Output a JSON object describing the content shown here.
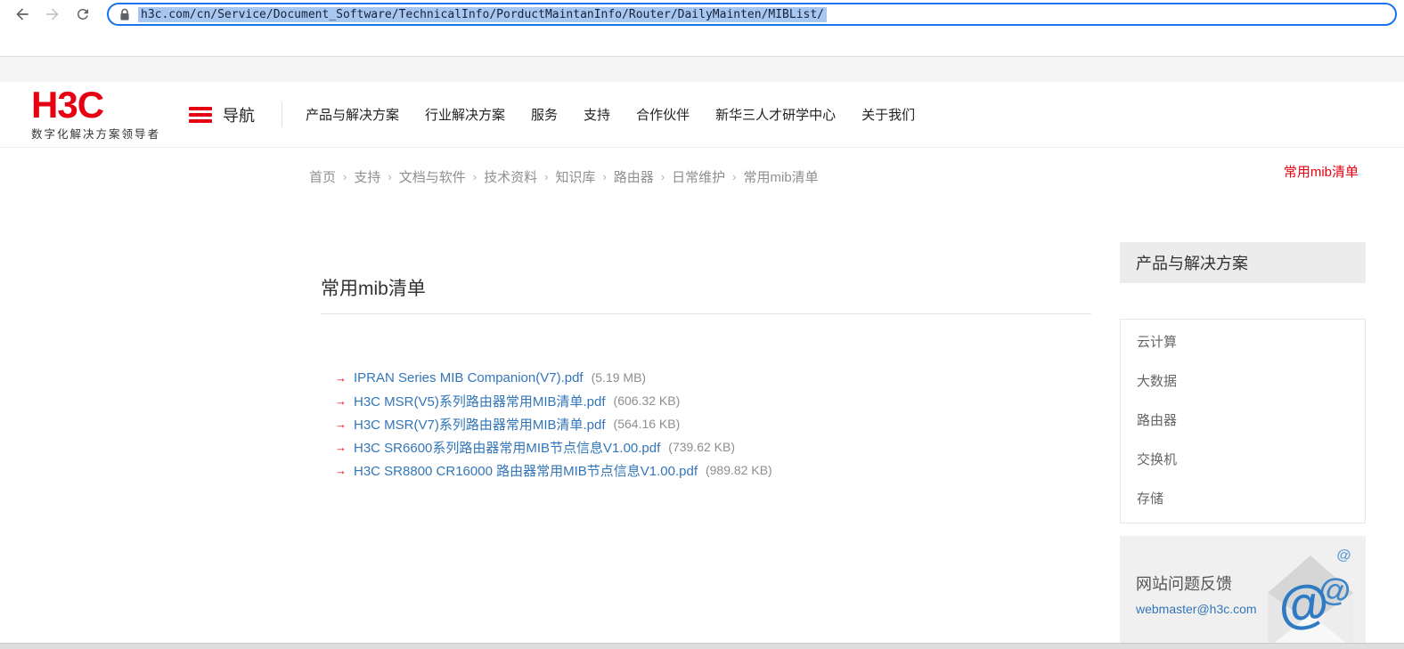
{
  "colors": {
    "brand_red": "#e60012",
    "link_blue": "#3376b8",
    "focus_ring": "#1a73e8",
    "url_text": "#17223a",
    "url_selection_bg": "#a8c7f0",
    "box_gray": "#ececec",
    "feedback_gray": "#f0f0f0",
    "border_gray": "#e6e6e6",
    "chrome_icon": "#5f6368",
    "chrome_icon_disabled": "#c1c5cb"
  },
  "browser": {
    "url": "h3c.com/cn/Service/Document_Software/TechnicalInfo/PorductMaintanInfo/Router/DailyMainten/MIBList/"
  },
  "header": {
    "logo": "H3C",
    "tagline": "数字化解决方案领导者",
    "nav_toggle_label": "导航",
    "nav_items": [
      "产品与解决方案",
      "行业解决方案",
      "服务",
      "支持",
      "合作伙伴",
      "新华三人才研学中心",
      "关于我们"
    ]
  },
  "breadcrumb": {
    "separator": "›",
    "items": [
      "首页",
      "支持",
      "文档与软件",
      "技术资料",
      "知识库",
      "路由器",
      "日常维护",
      "常用mib清单"
    ],
    "current_page_label": "常用mib清单"
  },
  "main": {
    "title": "常用mib清单",
    "bullet_glyph": "→",
    "files": [
      {
        "name": "IPRAN Series MIB Companion(V7).pdf",
        "size": "(5.19 MB)"
      },
      {
        "name": "H3C MSR(V5)系列路由器常用MIB清单.pdf",
        "size": "(606.32 KB)"
      },
      {
        "name": "H3C MSR(V7)系列路由器常用MIB清单.pdf",
        "size": "(564.16 KB)"
      },
      {
        "name": "H3C SR6600系列路由器常用MIB节点信息V1.00.pdf",
        "size": "(739.62 KB)"
      },
      {
        "name": "H3C SR8800 CR16000 路由器常用MIB节点信息V1.00.pdf",
        "size": "(989.82 KB)"
      }
    ]
  },
  "sidebar": {
    "title": "产品与解决方案",
    "items": [
      "云计算",
      "大数据",
      "路由器",
      "交换机",
      "存储"
    ],
    "feedback": {
      "title": "网站问题反馈",
      "email": "webmaster@h3c.com",
      "at_glyph": "@"
    }
  }
}
